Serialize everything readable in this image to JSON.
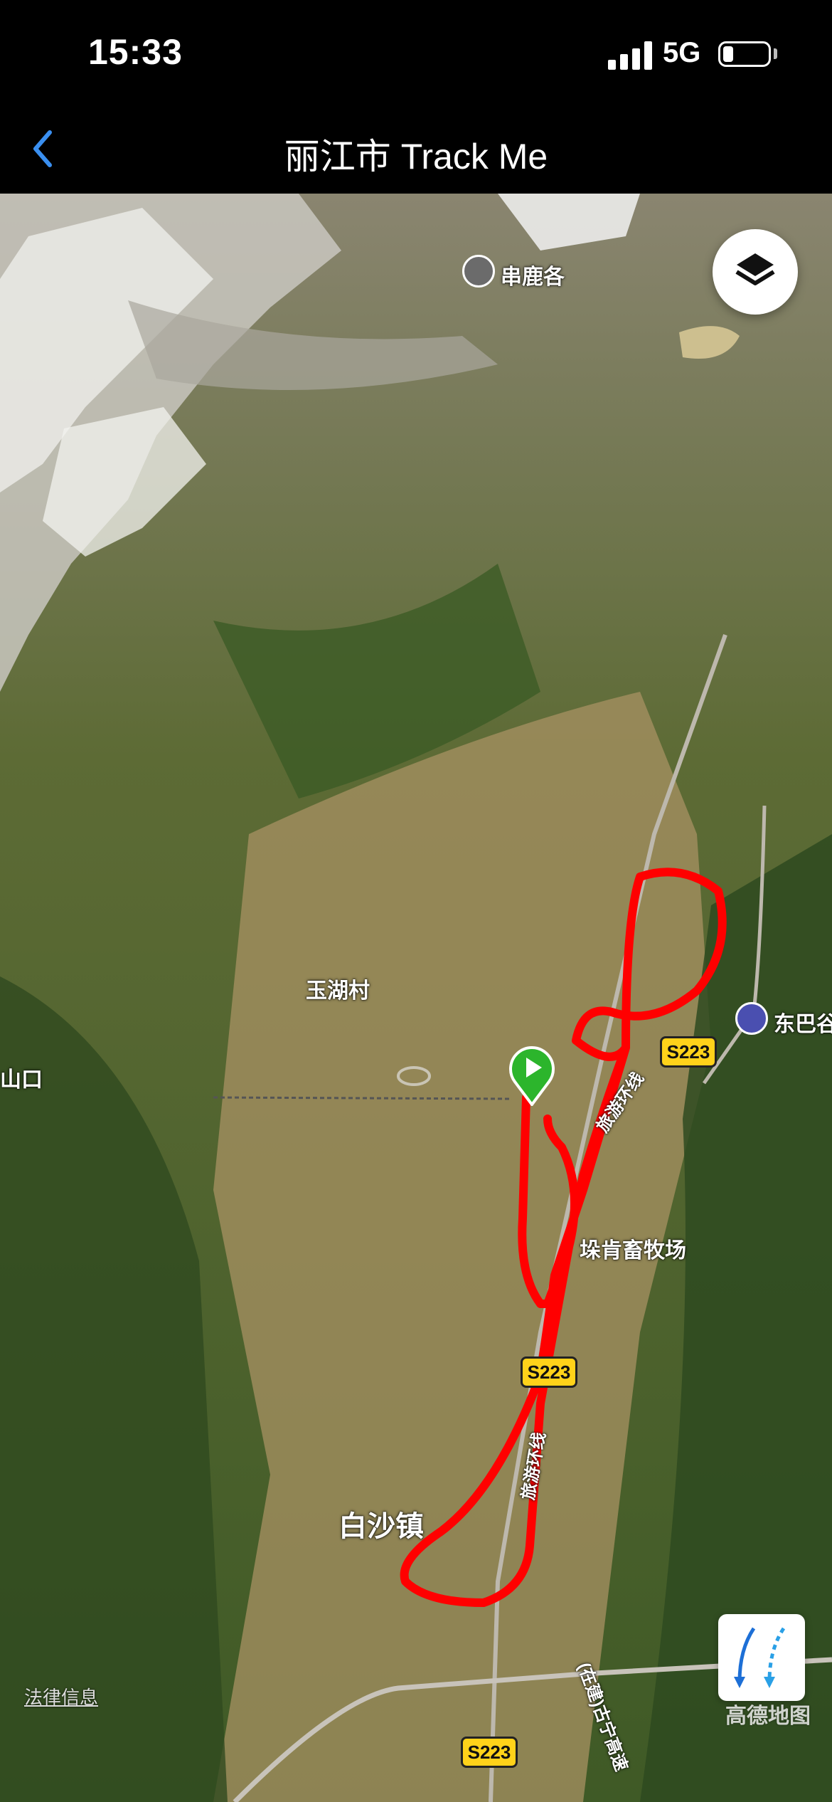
{
  "status_bar": {
    "time": "15:33",
    "network": "5G"
  },
  "nav": {
    "title": "丽江市 Track Me",
    "back_icon": "chevron-left-icon"
  },
  "map": {
    "labels": {
      "peak": "串鹿各",
      "village": "玉湖村",
      "east_valley": "东巴谷",
      "left_edge": "山口",
      "ranch": "垛肯畜牧场",
      "town": "白沙镇",
      "ring_road_1": "旅游环线",
      "ring_road_2": "旅游环线",
      "expressway": "(在建)古宁高速"
    },
    "road_shields": [
      "S223",
      "S223",
      "S223"
    ],
    "legal": "法律信息",
    "watermark": "高德地图",
    "colors": {
      "track": "#ff0000",
      "marker": "#2cb52c",
      "shield": "#ffd21a"
    }
  }
}
